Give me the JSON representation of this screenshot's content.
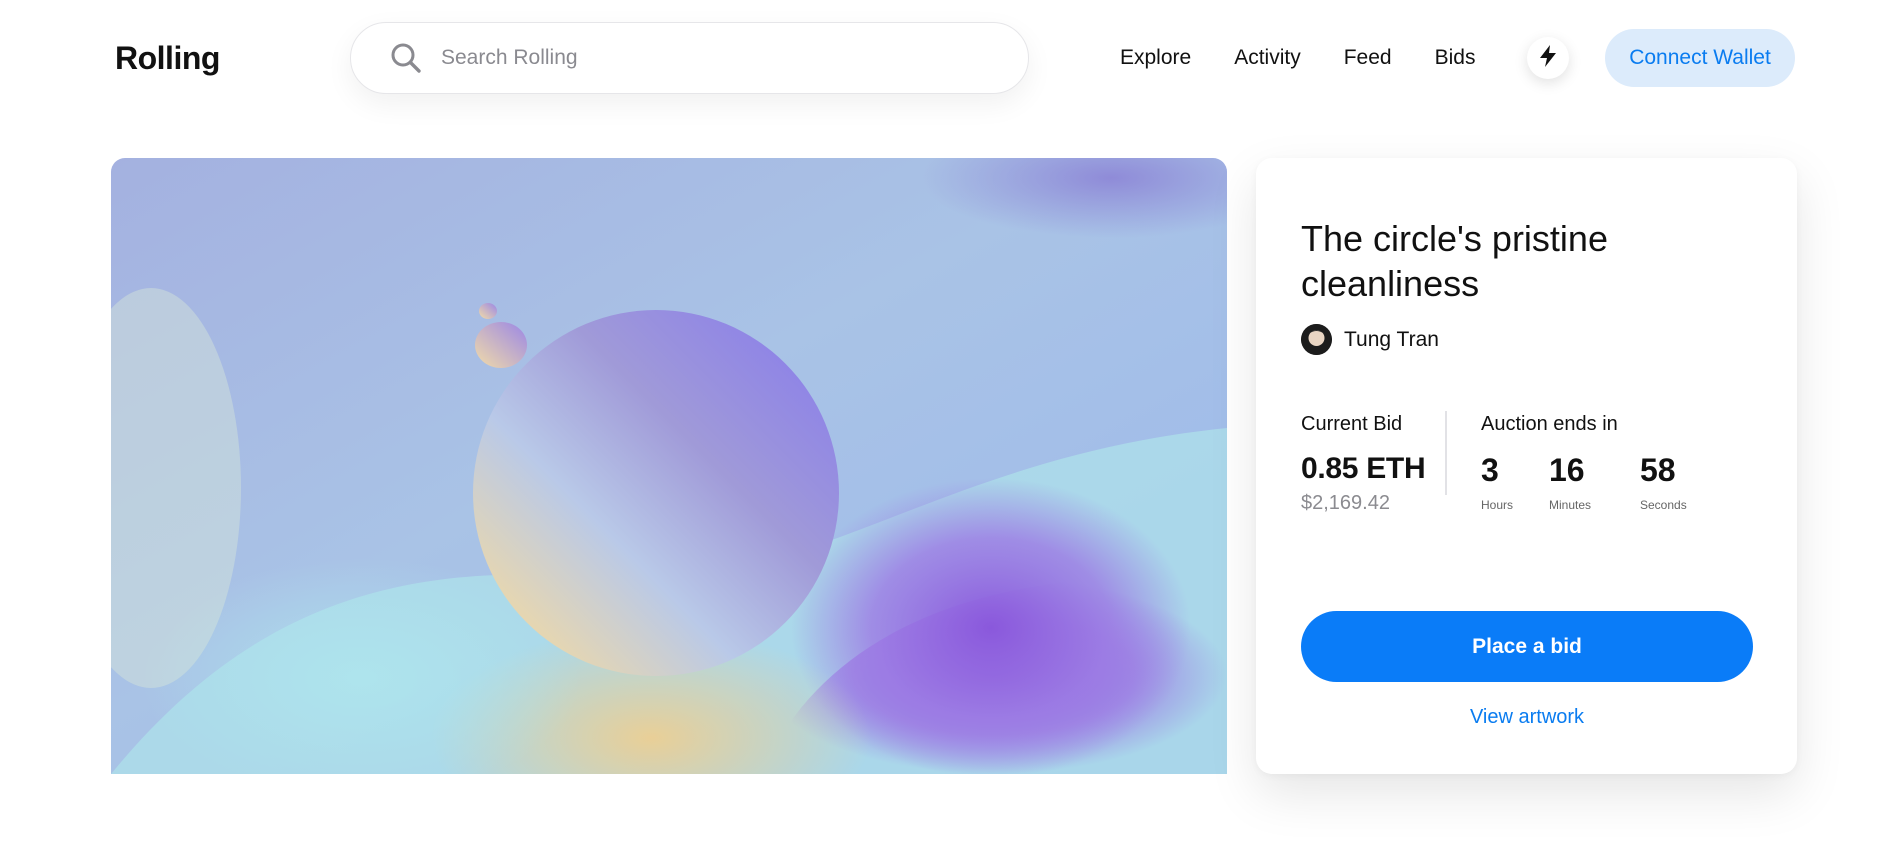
{
  "header": {
    "logo": "Rolling",
    "search": {
      "placeholder": "Search Rolling",
      "icon": "search-icon"
    },
    "nav": [
      {
        "label": "Explore"
      },
      {
        "label": "Activity"
      },
      {
        "label": "Feed"
      },
      {
        "label": "Bids"
      }
    ],
    "activity_icon": "lightning-bolt-icon",
    "connect_label": "Connect Wallet"
  },
  "artwork": {
    "colors": [
      "#a7b3e2",
      "#8f80e6",
      "#8b5ad9",
      "#a6e3ea",
      "#e7cf9d"
    ]
  },
  "card": {
    "title": "The circle's pristine cleanliness",
    "creator": "Tung Tran",
    "current_bid_label": "Current Bid",
    "current_bid_eth": "0.85 ETH",
    "current_bid_usd": "$2,169.42",
    "auction_label": "Auction ends in",
    "countdown": {
      "hours": "3",
      "hours_label": "Hours",
      "minutes": "16",
      "minutes_label": "Minutes",
      "seconds": "58",
      "seconds_label": "Seconds"
    },
    "place_bid_label": "Place a bid",
    "view_artwork_label": "View artwork"
  },
  "colors": {
    "accent": "#0a7cf8",
    "connect_bg": "#dcebfb"
  }
}
